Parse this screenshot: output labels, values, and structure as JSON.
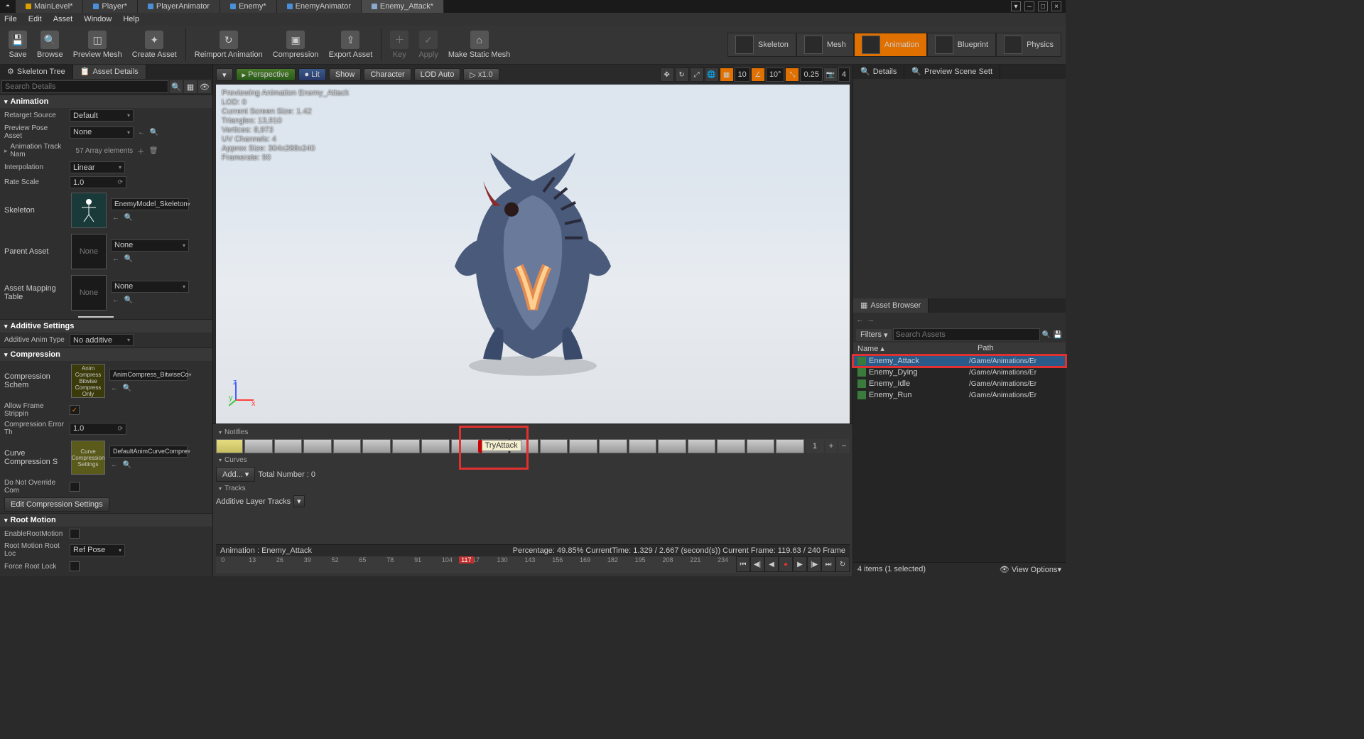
{
  "tabs": [
    "MainLevel*",
    "Player*",
    "PlayerAnimator",
    "Enemy*",
    "EnemyAnimator",
    "Enemy_Attack*"
  ],
  "activeTab": 5,
  "menu": [
    "File",
    "Edit",
    "Asset",
    "Window",
    "Help"
  ],
  "toolbar": [
    {
      "label": "Save",
      "icon": "💾"
    },
    {
      "label": "Browse",
      "icon": "🔍"
    },
    {
      "label": "Preview Mesh",
      "icon": "◫"
    },
    {
      "label": "Create Asset",
      "icon": "✦"
    },
    {
      "label": "Reimport Animation",
      "icon": "↻"
    },
    {
      "label": "Compression",
      "icon": "▣"
    },
    {
      "label": "Export Asset",
      "icon": "⇪"
    },
    {
      "label": "Key",
      "icon": "＋",
      "dim": true
    },
    {
      "label": "Apply",
      "icon": "✓",
      "dim": true
    },
    {
      "label": "Make Static Mesh",
      "icon": "⌂"
    }
  ],
  "modes": [
    "Skeleton",
    "Mesh",
    "Animation",
    "Blueprint",
    "Physics"
  ],
  "activeMode": 2,
  "leftTabs": [
    "Skeleton Tree",
    "Asset Details"
  ],
  "searchPlaceholder": "Search Details",
  "details": {
    "animation": {
      "header": "Animation",
      "retargetSource": {
        "lbl": "Retarget Source",
        "val": "Default"
      },
      "previewPose": {
        "lbl": "Preview Pose Asset",
        "val": "None"
      },
      "trackNames": {
        "lbl": "Animation Track Nam",
        "val": "57 Array elements"
      },
      "interp": {
        "lbl": "Interpolation",
        "val": "Linear"
      },
      "rateScale": {
        "lbl": "Rate Scale",
        "val": "1.0"
      },
      "skeleton": {
        "lbl": "Skeleton",
        "val": "EnemyModel_Skeleton"
      },
      "parent": {
        "lbl": "Parent Asset",
        "val": "None",
        "thumb": "None"
      },
      "mapping": {
        "lbl": "Asset Mapping Table",
        "val": "None",
        "thumb": "None"
      }
    },
    "additive": {
      "header": "Additive Settings",
      "type": {
        "lbl": "Additive Anim Type",
        "val": "No additive"
      }
    },
    "compression": {
      "header": "Compression",
      "scheme": {
        "lbl": "Compression Schem",
        "btn": "Anim Compress Bitwise Compress Only",
        "val": "AnimCompress_BitwiseCo"
      },
      "allowStrip": {
        "lbl": "Allow Frame Strippin",
        "on": true
      },
      "errTh": {
        "lbl": "Compression Error Th",
        "val": "1.0"
      },
      "curveComp": {
        "lbl": "Curve Compression S",
        "btn": "Curve Compression Settings",
        "val": "DefaultAnimCurveCompre"
      },
      "noOverride": {
        "lbl": "Do Not Override Com",
        "on": false
      },
      "editBtn": "Edit Compression Settings"
    },
    "rootMotion": {
      "header": "Root Motion",
      "enable": {
        "lbl": "EnableRootMotion",
        "on": false
      },
      "rootLock": {
        "lbl": "Root Motion Root Loc",
        "val": "Ref Pose"
      },
      "forceLock": {
        "lbl": "Force Root Lock",
        "on": false
      }
    }
  },
  "viewport": {
    "chips": [
      "Perspective",
      "Lit",
      "Show",
      "Character",
      "LOD Auto",
      "x1.0"
    ],
    "overlay": [
      "Previewing Animation Enemy_Attack",
      "LOD: 0",
      "Current Screen Size: 1.42",
      "Triangles: 13,910",
      "Vertices: 8,973",
      "UV Channels: 4",
      "Approx Size: 304x268x240",
      "Framerate: 90"
    ],
    "gridNums": {
      "a": "10",
      "b": "10°",
      "c": "0.25",
      "d": "4"
    }
  },
  "timeline": {
    "notifies": "Notifies",
    "notifyLabel": "TryAttack",
    "notifyTrack": "1",
    "curves": "Curves",
    "addBtn": "Add...",
    "totalNum": "Total Number : 0",
    "tracks": "Tracks",
    "addLayer": "Additive Layer Tracks",
    "animLabel": "Animation :  Enemy_Attack",
    "status": "Percentage:  49.85% CurrentTime:  1.329 / 2.667 (second(s)) Current Frame:  119.63 / 240 Frame",
    "ticks": [
      "0",
      "13",
      "26",
      "39",
      "52",
      "65",
      "78",
      "91",
      "104",
      "117",
      "130",
      "143",
      "156",
      "169",
      "182",
      "195",
      "208",
      "221",
      "234"
    ],
    "headFrame": "117"
  },
  "rightTabs": [
    "Details",
    "Preview Scene Sett"
  ],
  "assetBrowser": {
    "title": "Asset Browser",
    "filters": "Filters",
    "searchPlaceholder": "Search Assets",
    "cols": {
      "name": "Name",
      "path": "Path"
    },
    "rows": [
      {
        "name": "Enemy_Attack",
        "path": "/Game/Animations/Er",
        "sel": true
      },
      {
        "name": "Enemy_Dying",
        "path": "/Game/Animations/Er"
      },
      {
        "name": "Enemy_Idle",
        "path": "/Game/Animations/Er"
      },
      {
        "name": "Enemy_Run",
        "path": "/Game/Animations/Er"
      }
    ],
    "status": "4 items (1 selected)",
    "viewOpt": "View Options"
  }
}
